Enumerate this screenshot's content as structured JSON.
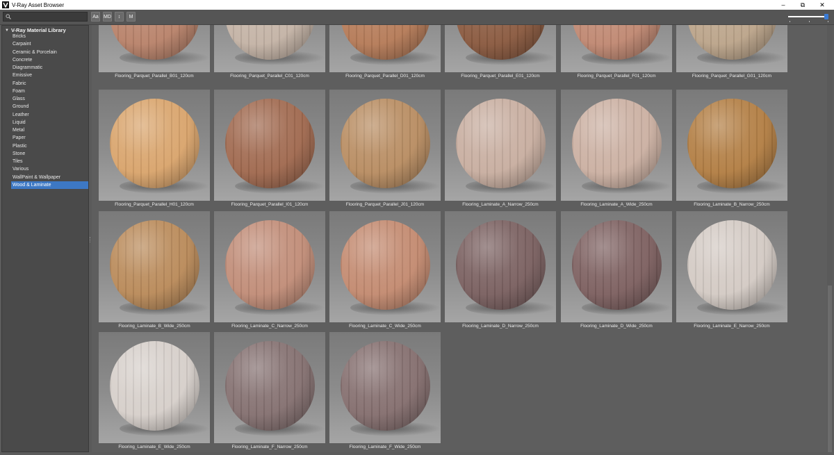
{
  "window": {
    "title": "V-Ray Asset Browser",
    "controls": {
      "minimize": "–",
      "restore": "⧉",
      "close": "✕"
    },
    "app_icon": "vray-logo-icon"
  },
  "toolbar": {
    "search": {
      "value": "",
      "placeholder": "",
      "icon": "search-icon"
    },
    "buttons": {
      "sort_alpha": "Aa",
      "sort_md": "MD",
      "sort_order": "↕",
      "mode": "M"
    },
    "zoom_slider_level": 0.95
  },
  "sidebar": {
    "root_label": "V-Ray Material Library",
    "items": [
      {
        "label": "Bricks"
      },
      {
        "label": "Carpaint"
      },
      {
        "label": "Ceramic & Porcelain"
      },
      {
        "label": "Concrete"
      },
      {
        "label": "Diagrammatic"
      },
      {
        "label": "Emissive"
      },
      {
        "label": "Fabric"
      },
      {
        "label": "Foam"
      },
      {
        "label": "Glass"
      },
      {
        "label": "Ground"
      },
      {
        "label": "Leather"
      },
      {
        "label": "Liquid"
      },
      {
        "label": "Metal"
      },
      {
        "label": "Paper"
      },
      {
        "label": "Plastic"
      },
      {
        "label": "Stone"
      },
      {
        "label": "Tiles"
      },
      {
        "label": "Various"
      },
      {
        "label": "WallPaint & Wallpaper"
      },
      {
        "label": "Wood & Laminate",
        "selected": true
      }
    ]
  },
  "materials": [
    {
      "name": "Flooring_Parquet_Parallel_B01_120cm",
      "color": "#b8826a"
    },
    {
      "name": "Flooring_Parquet_Parallel_C01_120cm",
      "color": "#c4b3a6"
    },
    {
      "name": "Flooring_Parquet_Parallel_D01_120cm",
      "color": "#b57b58"
    },
    {
      "name": "Flooring_Parquet_Parallel_E01_120cm",
      "color": "#8a5a40"
    },
    {
      "name": "Flooring_Parquet_Parallel_F01_120cm",
      "color": "#c08872"
    },
    {
      "name": "Flooring_Parquet_Parallel_G01_120cm",
      "color": "#bba48a"
    },
    {
      "name": "Flooring_Parquet_Parallel_H01_120cm",
      "color": "#d9a46c"
    },
    {
      "name": "Flooring_Parquet_Parallel_I01_120cm",
      "color": "#a0694f"
    },
    {
      "name": "Flooring_Parquet_Parallel_J01_120cm",
      "color": "#b88d62"
    },
    {
      "name": "Flooring_Laminate_A_Narrow_250cm",
      "color": "#c8aea0"
    },
    {
      "name": "Flooring_Laminate_A_Wide_250cm",
      "color": "#cbb0a2"
    },
    {
      "name": "Flooring_Laminate_B_Narrow_250cm",
      "color": "#b27e44"
    },
    {
      "name": "Flooring_Laminate_B_Wide_250cm",
      "color": "#b98a5a"
    },
    {
      "name": "Flooring_Laminate_C_Narrow_250cm",
      "color": "#c18d78"
    },
    {
      "name": "Flooring_Laminate_C_Wide_250cm",
      "color": "#c38a70"
    },
    {
      "name": "Flooring_Laminate_D_Narrow_250cm",
      "color": "#7a6060"
    },
    {
      "name": "Flooring_Laminate_D_Wide_250cm",
      "color": "#7d6060"
    },
    {
      "name": "Flooring_Laminate_E_Narrow_250cm",
      "color": "#d3cac4"
    },
    {
      "name": "Flooring_Laminate_E_Wide_250cm",
      "color": "#d6cfca"
    },
    {
      "name": "Flooring_Laminate_F_Narrow_250cm",
      "color": "#847070"
    },
    {
      "name": "Flooring_Laminate_F_Wide_250cm",
      "color": "#846e6e"
    }
  ]
}
